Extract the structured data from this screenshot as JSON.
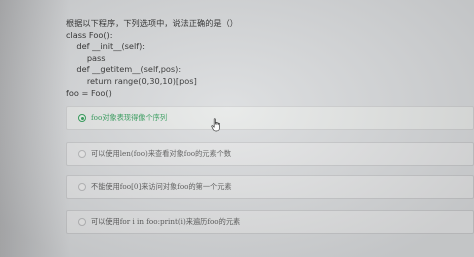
{
  "question": {
    "lines": [
      "根据以下程序，下列选项中，说法正确的是（）",
      "class Foo():",
      "    def __init__(self):",
      "        pass",
      "    def __getitem__(self,pos):",
      "        return range(0,30,10)[pos]",
      "foo = Foo()"
    ]
  },
  "options": [
    {
      "text": "foo对象表现得像个序列",
      "selected": true
    },
    {
      "text": "可以使用len(foo)来查看对象foo的元素个数",
      "selected": false
    },
    {
      "text": "不能使用foo[0]来访问对象foo的第一个元素",
      "selected": false
    },
    {
      "text": "可以使用for i in foo:print(i)来遍历foo的元素",
      "selected": false
    }
  ],
  "colors": {
    "selected_accent": "#2e9b57",
    "background": "#d9dbdd"
  },
  "icons": {
    "cursor": "hand-pointer-icon"
  }
}
